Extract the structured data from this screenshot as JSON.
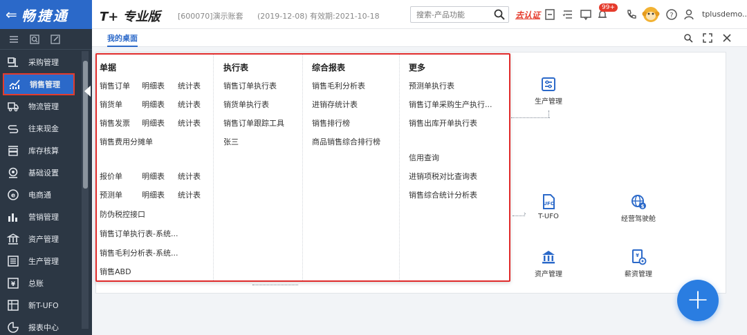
{
  "header": {
    "brand_arrow": "⇐",
    "brand_name": "畅捷通",
    "product": "T+ 专业版",
    "account": "[600070]演示账套",
    "dates": "(2019-12-08)  有效期:2021-10-18",
    "search_placeholder": "搜索-产品功能",
    "certify": "去认证",
    "badge": "99+",
    "user": "tplusdemo..."
  },
  "sidebar": {
    "items": [
      {
        "label": "采购管理",
        "icon": "purchase-icon"
      },
      {
        "label": "销售管理",
        "icon": "sales-icon",
        "active": true
      },
      {
        "label": "物流管理",
        "icon": "logistics-icon"
      },
      {
        "label": "往来现金",
        "icon": "cash-icon"
      },
      {
        "label": "库存核算",
        "icon": "inventory-icon"
      },
      {
        "label": "基础设置",
        "icon": "settings-icon"
      },
      {
        "label": "电商通",
        "icon": "ecommerce-icon"
      },
      {
        "label": "营销管理",
        "icon": "marketing-icon"
      },
      {
        "label": "资产管理",
        "icon": "asset-icon"
      },
      {
        "label": "生产管理",
        "icon": "production-icon"
      },
      {
        "label": "总账",
        "icon": "ledger-icon"
      },
      {
        "label": "新T-UFO",
        "icon": "tufo-icon"
      },
      {
        "label": "报表中心",
        "icon": "report-icon"
      }
    ]
  },
  "tabs": {
    "desktop": "我的桌面"
  },
  "workspace": {
    "widgets": [
      {
        "label": "生产管理",
        "icon": "production-icon"
      },
      {
        "label": "T-UFO",
        "icon": "ufo-icon"
      },
      {
        "label": "经营驾驶舱",
        "icon": "globe-dollar-icon"
      },
      {
        "label": "资产管理",
        "icon": "bank-icon"
      },
      {
        "label": "薪资管理",
        "icon": "payroll-icon"
      }
    ]
  },
  "menu": {
    "columns": [
      {
        "title": "单据"
      },
      {
        "title": "执行表"
      },
      {
        "title": "综合报表"
      },
      {
        "title": "更多"
      }
    ],
    "c1": {
      "r1": [
        "销售订单",
        "明细表",
        "统计表"
      ],
      "r2": [
        "销货单",
        "明细表",
        "统计表"
      ],
      "r3": [
        "销售发票",
        "明细表",
        "统计表"
      ],
      "r4": [
        "销售费用分摊单"
      ],
      "r5": [
        "报价单",
        "明细表",
        "统计表"
      ],
      "r6": [
        "预测单",
        "明细表",
        "统计表"
      ],
      "r7": [
        "防伪税控接口"
      ],
      "r8": [
        "销售订单执行表-系统..."
      ],
      "r9": [
        "销售毛利分析表-系统..."
      ],
      "r10": [
        "销售ABD"
      ]
    },
    "c2": [
      "销售订单执行表",
      "销货单执行表",
      "销售订单跟踪工具",
      "张三"
    ],
    "c3": [
      "销售毛利分析表",
      "进销存统计表",
      "销售排行榜",
      "商品销售综合排行榜"
    ],
    "c4": [
      "预测单执行表",
      "销售订单采购生产执行...",
      "销售出库开单执行表",
      "信用查询",
      "进销项税对比查询表",
      "销售综合统计分析表"
    ]
  },
  "colors": {
    "brand": "#2b69c9",
    "sidebar_bg": "#2c3744",
    "highlight": "#e02a2a",
    "fab": "#2a7de1"
  },
  "fab_symbol": "+"
}
